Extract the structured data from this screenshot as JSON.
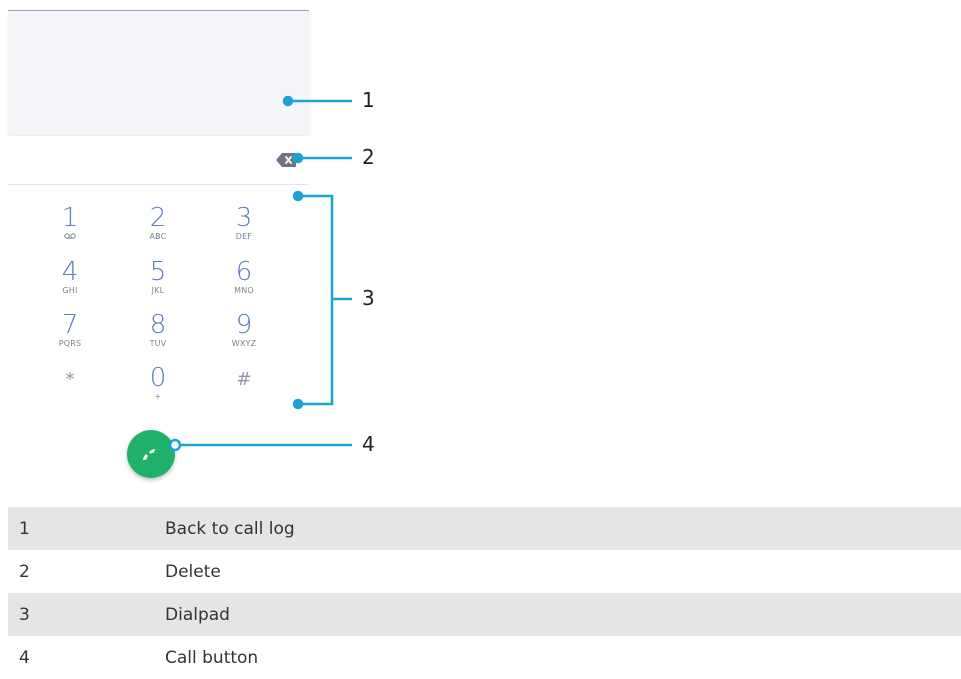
{
  "dialpad": {
    "keys": [
      {
        "digit": "1",
        "letters": "ꝏ"
      },
      {
        "digit": "2",
        "letters": "ABC"
      },
      {
        "digit": "3",
        "letters": "DEF"
      },
      {
        "digit": "4",
        "letters": "GHI"
      },
      {
        "digit": "5",
        "letters": "JKL"
      },
      {
        "digit": "6",
        "letters": "MNO"
      },
      {
        "digit": "7",
        "letters": "PQRS"
      },
      {
        "digit": "8",
        "letters": "TUV"
      },
      {
        "digit": "9",
        "letters": "WXYZ"
      },
      {
        "digit": "*",
        "letters": ""
      },
      {
        "digit": "0",
        "letters": "+"
      },
      {
        "digit": "#",
        "letters": ""
      }
    ]
  },
  "icons": {
    "delete": "backspace-icon",
    "call": "phone-icon",
    "voicemail": "voicemail-icon"
  },
  "colors": {
    "callout": "#1aa3d8",
    "call_button": "#21b26a",
    "digits": "#5b7cc1",
    "legend_shade": "#e5e5e5"
  },
  "callouts": {
    "c1": "1",
    "c2": "2",
    "c3": "3",
    "c4": "4"
  },
  "legend": {
    "rows": [
      {
        "number": "1",
        "text": "Back to call log"
      },
      {
        "number": "2",
        "text": "Delete"
      },
      {
        "number": "3",
        "text": "Dialpad"
      },
      {
        "number": "4",
        "text": "Call button"
      }
    ]
  }
}
